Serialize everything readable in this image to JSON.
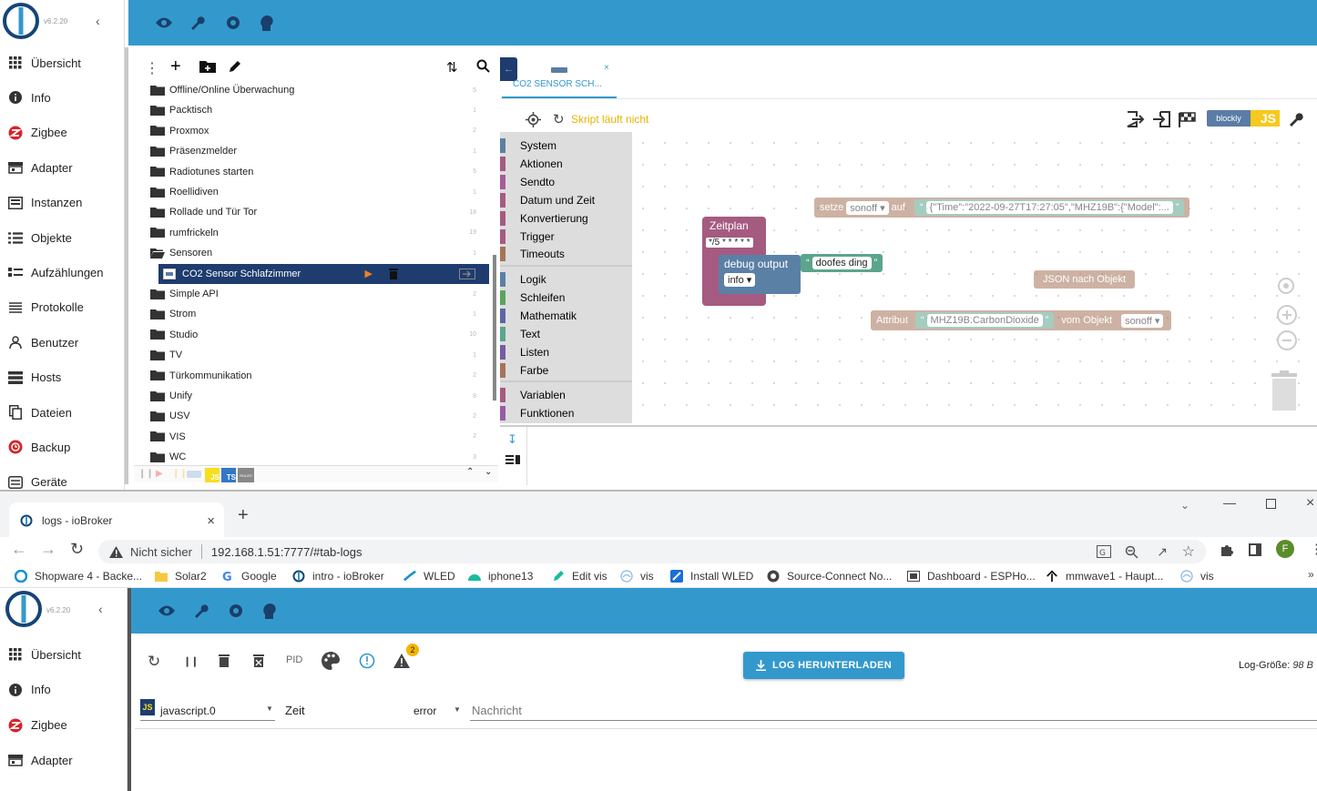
{
  "app": {
    "version": "v6.2.20",
    "sidebar_items": [
      {
        "label": "Übersicht",
        "icon": "grid-icon"
      },
      {
        "label": "Info",
        "icon": "info-icon"
      },
      {
        "label": "Zigbee",
        "icon": "zigbee-icon"
      },
      {
        "label": "Adapter",
        "icon": "adapter-icon"
      },
      {
        "label": "Instanzen",
        "icon": "instances-icon"
      },
      {
        "label": "Objekte",
        "icon": "objects-icon"
      },
      {
        "label": "Aufzählungen",
        "icon": "enums-icon"
      },
      {
        "label": "Protokolle",
        "icon": "logs-icon"
      },
      {
        "label": "Benutzer",
        "icon": "user-icon"
      },
      {
        "label": "Hosts",
        "icon": "hosts-icon"
      },
      {
        "label": "Dateien",
        "icon": "files-icon"
      },
      {
        "label": "Backup",
        "icon": "backup-icon"
      },
      {
        "label": "Geräte",
        "icon": "devices-icon"
      }
    ],
    "topbar_icons": [
      "eye-icon",
      "wrench-icon",
      "gear-icon",
      "head-icon"
    ]
  },
  "tree": {
    "rows": [
      {
        "label": "Offline/Online Überwachung",
        "count": "5"
      },
      {
        "label": "Packtisch",
        "count": "1"
      },
      {
        "label": "Proxmox",
        "count": "2"
      },
      {
        "label": "Präsenzmelder",
        "count": "1"
      },
      {
        "label": "Radiotunes starten",
        "count": "5"
      },
      {
        "label": "Roellidiven",
        "count": "1"
      },
      {
        "label": "Rollade und Tür Tor",
        "count": "18"
      },
      {
        "label": "rumfrickeln",
        "count": "19"
      },
      {
        "label": "Sensoren",
        "count": "1"
      },
      {
        "label": "CO2 Sensor Schlafzimmer",
        "count": ""
      },
      {
        "label": "Simple API",
        "count": "2"
      },
      {
        "label": "Strom",
        "count": "1"
      },
      {
        "label": "Studio",
        "count": "10"
      },
      {
        "label": "TV",
        "count": "1"
      },
      {
        "label": "Türkommunikation",
        "count": "2"
      },
      {
        "label": "Unify",
        "count": "8"
      },
      {
        "label": "USV",
        "count": "2"
      },
      {
        "label": "VIS",
        "count": "2"
      },
      {
        "label": "WC",
        "count": "3"
      }
    ],
    "bottom_badges": [
      "JS",
      "TS",
      "RULES"
    ]
  },
  "editor": {
    "tab_label": "CO2 SENSOR SCH...",
    "status": "Skript läuft nicht",
    "mode_blockly": "blockly",
    "mode_js": "JS",
    "palette": [
      {
        "label": "System",
        "color": "#5b80a5"
      },
      {
        "label": "Aktionen",
        "color": "#a55b80"
      },
      {
        "label": "Sendto",
        "color": "#a55b99"
      },
      {
        "label": "Datum und Zeit",
        "color": "#a55b80"
      },
      {
        "label": "Konvertierung",
        "color": "#a55b80"
      },
      {
        "label": "Trigger",
        "color": "#a55b80"
      },
      {
        "label": "Timeouts",
        "color": "#a5745b"
      },
      {
        "label": "Logik",
        "color": "#5b80a5"
      },
      {
        "label": "Schleifen",
        "color": "#5ba55b"
      },
      {
        "label": "Mathematik",
        "color": "#5b67a5"
      },
      {
        "label": "Text",
        "color": "#5ba58c"
      },
      {
        "label": "Listen",
        "color": "#745ba5"
      },
      {
        "label": "Farbe",
        "color": "#a5745b"
      },
      {
        "label": "Variablen",
        "color": "#a55b80"
      },
      {
        "label": "Funktionen",
        "color": "#995ba5"
      }
    ],
    "blocks": {
      "setze_label": "setze",
      "setze_target": "sonoff",
      "auf_label": "auf",
      "json_text": "{\"Time\":\"2022-09-27T17:27:05\",\"MHZ19B\":{\"Model\":...",
      "zeitplan_label": "Zeitplan",
      "cron": "*/5 * * * * *",
      "debug_label": "debug output",
      "debug_text": "doofes ding",
      "debug_level": "info",
      "json_nach_objekt": "JSON nach Objekt",
      "attribut_label": "Attribut",
      "attribut_value": "MHZ19B.CarbonDioxide",
      "vom_objekt_label": "vom Objekt",
      "vom_objekt_value": "sonoff"
    }
  },
  "browser": {
    "tab_title": "logs - ioBroker",
    "security": "Nicht sicher",
    "url": "192.168.1.51:7777/#tab-logs",
    "profile_initial": "F",
    "bookmarks": [
      {
        "label": "Shopware 4 - Backe...",
        "icon": "shopware-icon"
      },
      {
        "label": "Solar2",
        "icon": "folder-icon"
      },
      {
        "label": "Google",
        "icon": "google-icon"
      },
      {
        "label": "intro - ioBroker",
        "icon": "iobroker-icon"
      },
      {
        "label": "WLED",
        "icon": "wled-icon"
      },
      {
        "label": "iphone13",
        "icon": "circle-icon"
      },
      {
        "label": "Edit vis",
        "icon": "vis-edit-icon"
      },
      {
        "label": "vis",
        "icon": "vis-icon"
      },
      {
        "label": "Install WLED",
        "icon": "wled-install-icon"
      },
      {
        "label": "Source-Connect No...",
        "icon": "source-icon"
      },
      {
        "label": "Dashboard - ESPHo...",
        "icon": "dashboard-icon"
      },
      {
        "label": "mmwave1 - Haupt...",
        "icon": "mmwave-icon"
      },
      {
        "label": "vis",
        "icon": "vis-icon"
      }
    ]
  },
  "inner": {
    "version": "v6.2.20",
    "sidebar_items": [
      {
        "label": "Übersicht",
        "icon": "grid-icon"
      },
      {
        "label": "Info",
        "icon": "info-icon"
      },
      {
        "label": "Zigbee",
        "icon": "zigbee-icon"
      },
      {
        "label": "Adapter",
        "icon": "adapter-icon"
      }
    ],
    "logs": {
      "pid_label": "PID",
      "warning_badge": "2",
      "download_label": "LOG HERUNTERLADEN",
      "log_size_label": "Log-Größe:",
      "log_size_value": "98 B",
      "source_filter": "javascript.0",
      "col_time": "Zeit",
      "level_filter": "error",
      "col_message": "Nachricht"
    }
  }
}
